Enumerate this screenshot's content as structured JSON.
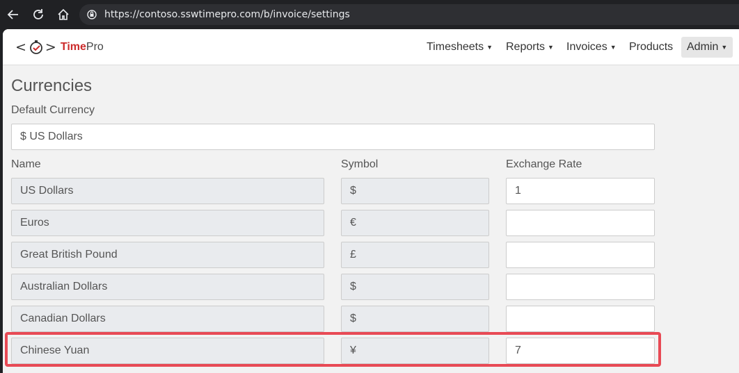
{
  "browser": {
    "url": "https://contoso.sswtimepro.com/b/invoice/settings"
  },
  "navbar": {
    "logo_left": "<",
    "logo_right": ">",
    "logo_time": "Time",
    "logo_pro": "Pro",
    "menu": {
      "timesheets": "Timesheets",
      "reports": "Reports",
      "invoices": "Invoices",
      "products": "Products",
      "admin": "Admin"
    }
  },
  "page": {
    "title": "Currencies",
    "default_currency_label": "Default Currency",
    "default_currency_value": "$ US Dollars",
    "columns": {
      "name": "Name",
      "symbol": "Symbol",
      "rate": "Exchange Rate"
    },
    "rows": [
      {
        "name": "US Dollars",
        "symbol": "$",
        "rate": "1"
      },
      {
        "name": "Euros",
        "symbol": "€",
        "rate": ""
      },
      {
        "name": "Great British Pound",
        "symbol": "£",
        "rate": ""
      },
      {
        "name": "Australian Dollars",
        "symbol": "$",
        "rate": ""
      },
      {
        "name": "Canadian Dollars",
        "symbol": "$",
        "rate": ""
      },
      {
        "name": "Chinese Yuan",
        "symbol": "¥",
        "rate": "7"
      }
    ]
  },
  "colors": {
    "highlight": "#e84a55",
    "brand": "#cc2b2b"
  }
}
